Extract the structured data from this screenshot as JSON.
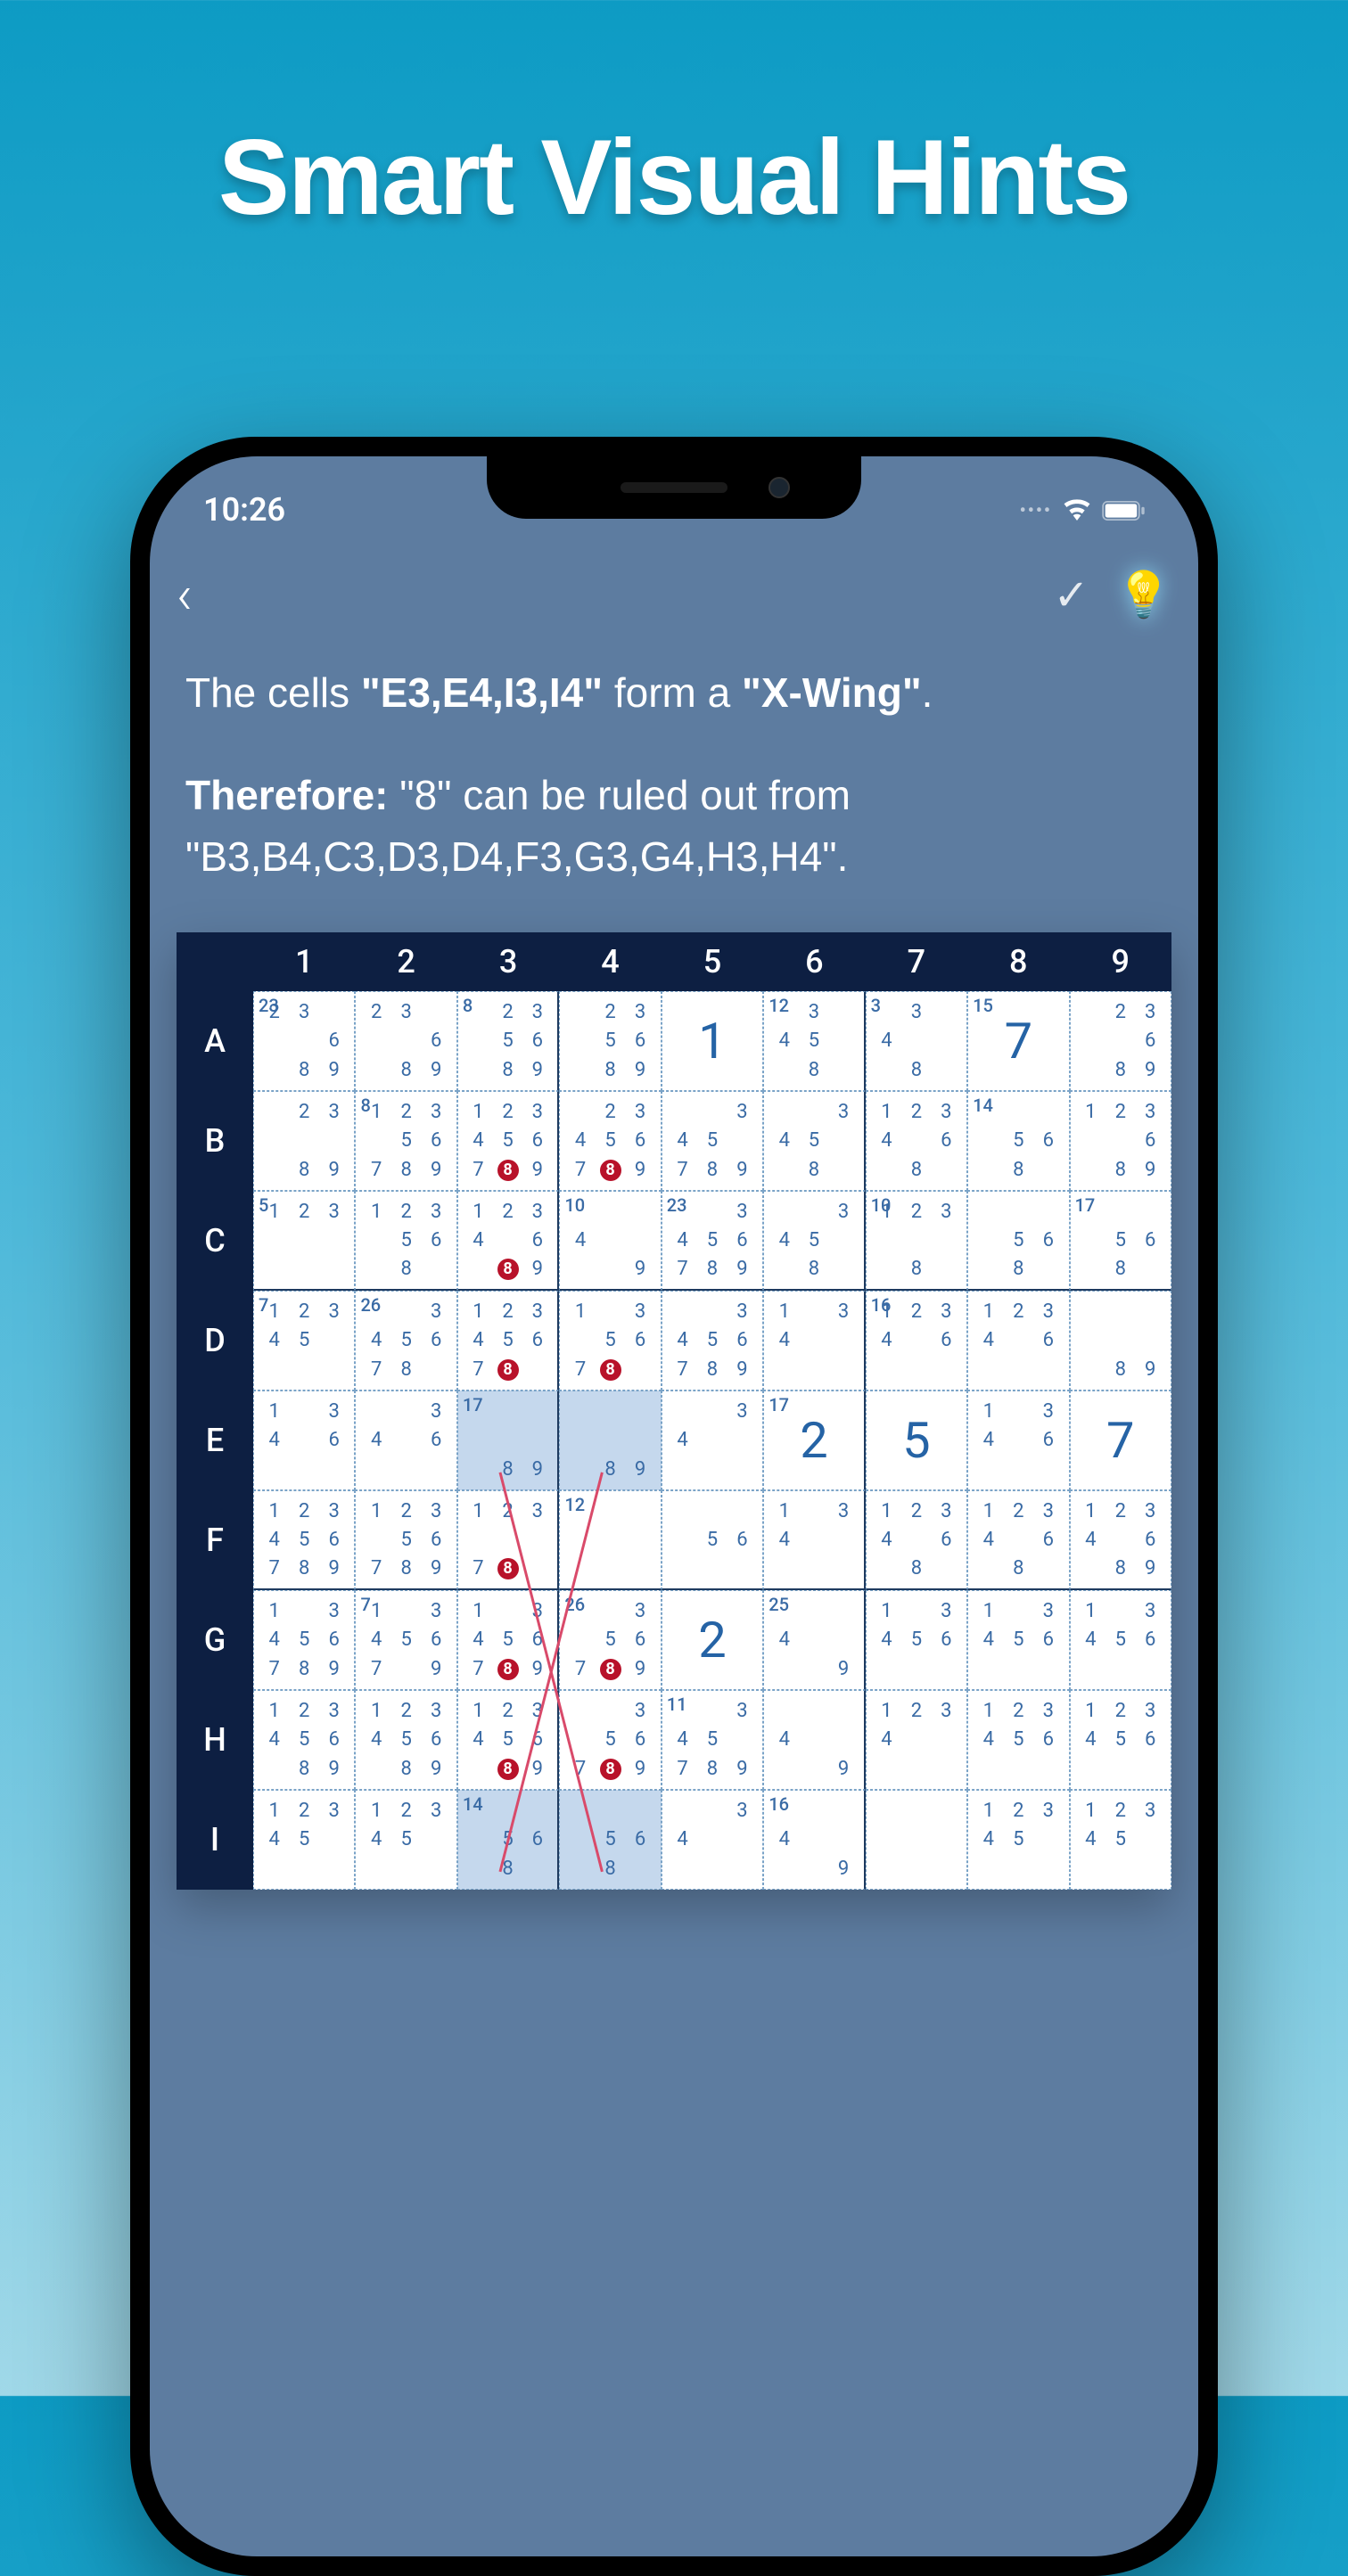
{
  "marketing_title": "Smart Visual Hints",
  "statusbar": {
    "time": "10:26"
  },
  "hint": {
    "line1_prefix": "The cells ",
    "line1_cells": "\"E3,E4,I3,I4\"",
    "line1_mid": " form a ",
    "line1_pattern": "\"X-Wing\"",
    "line1_suffix": ".",
    "line2_prefix": "Therefore: ",
    "line2_body": "\"8\" can be ruled out from \"B3,B4,C3,D3,D4,F3,G3,G4,H3,H4\"."
  },
  "columns": [
    "1",
    "2",
    "3",
    "4",
    "5",
    "6",
    "7",
    "8",
    "9"
  ],
  "rows": [
    "A",
    "B",
    "C",
    "D",
    "E",
    "F",
    "G",
    "H",
    "I"
  ],
  "big_values": {
    "A5": "1",
    "A8": "7",
    "E6": "2",
    "E7": "5",
    "E9": "7",
    "G5": "2"
  },
  "highlights": [
    "E3",
    "E4",
    "I3",
    "I4"
  ],
  "cages": {
    "A1": "23",
    "A3": "8",
    "A6": "12",
    "A7": "3",
    "A8": "15",
    "B2": "8",
    "B8": "14",
    "C1": "5",
    "C4": "10",
    "C5": "23",
    "C7": "10",
    "C9": "17",
    "D1": "7",
    "D2": "26",
    "D7": "16",
    "E3": "17",
    "E6": "17",
    "F4": "12",
    "G2": "7",
    "G4": "26",
    "G6": "25",
    "H5": "11",
    "I3": "14",
    "I6": "16"
  },
  "candidates": {
    "A1": [
      "2",
      "3",
      "",
      "",
      "",
      "6",
      "",
      "8",
      "9"
    ],
    "A2": [
      "2",
      "3",
      "",
      "",
      "",
      "6",
      "",
      "8",
      "9"
    ],
    "A3": [
      "",
      "2",
      "3",
      "",
      "5",
      "6",
      "",
      "8",
      "9"
    ],
    "A4": [
      "",
      "2",
      "3",
      "",
      "5",
      "6",
      "",
      "8",
      "9"
    ],
    "A6": [
      "",
      "3",
      "",
      "4",
      "5",
      "",
      "",
      "8",
      ""
    ],
    "A7": [
      "",
      "3",
      "",
      "4",
      "",
      "",
      "",
      "8",
      ""
    ],
    "A9": [
      "",
      "2",
      "3",
      "",
      "",
      "6",
      "",
      "8",
      "9"
    ],
    "B1": [
      "",
      "2",
      "3",
      "",
      "",
      "",
      "",
      "8",
      "9"
    ],
    "B2": [
      "1",
      "2",
      "3",
      "",
      "5",
      "6",
      "7",
      "8",
      "9"
    ],
    "B3": [
      "1",
      "2",
      "3",
      "4",
      "5",
      "6",
      "7",
      "8",
      "9"
    ],
    "B4": [
      "",
      "2",
      "3",
      "4",
      "5",
      "6",
      "7",
      "8",
      "9"
    ],
    "B5": [
      "",
      "",
      "3",
      "4",
      "5",
      "",
      "7",
      "8",
      "9"
    ],
    "B6": [
      "",
      "",
      "3",
      "4",
      "5",
      "",
      "",
      "8",
      ""
    ],
    "B7": [
      "1",
      "2",
      "3",
      "4",
      "",
      "6",
      "",
      "8",
      ""
    ],
    "B8": [
      "",
      "",
      "",
      "",
      "5",
      "6",
      "",
      "8",
      ""
    ],
    "B9": [
      "1",
      "2",
      "3",
      "",
      "",
      "6",
      "",
      "8",
      "9"
    ],
    "C1": [
      "1",
      "2",
      "3",
      "",
      "",
      "",
      "",
      "",
      ""
    ],
    "C2": [
      "1",
      "2",
      "3",
      "",
      "5",
      "6",
      "",
      "8",
      ""
    ],
    "C3": [
      "1",
      "2",
      "3",
      "4",
      "",
      "6",
      "",
      "8",
      "9"
    ],
    "C4": [
      "",
      "",
      "",
      "4",
      "",
      "",
      "",
      "",
      "9"
    ],
    "C5": [
      "",
      "",
      "3",
      "4",
      "5",
      "6",
      "7",
      "8",
      "9"
    ],
    "C6": [
      "",
      "",
      "3",
      "4",
      "5",
      "",
      "",
      "8",
      ""
    ],
    "C7": [
      "1",
      "2",
      "3",
      "",
      "",
      "",
      "",
      "8",
      ""
    ],
    "C8": [
      "",
      "",
      "",
      "",
      "5",
      "6",
      "",
      "8",
      ""
    ],
    "C9": [
      "",
      "",
      "",
      "",
      "5",
      "6",
      "",
      "8",
      ""
    ],
    "D1": [
      "1",
      "2",
      "3",
      "4",
      "5",
      "",
      "",
      "",
      ""
    ],
    "D2": [
      "",
      "",
      "3",
      "4",
      "5",
      "6",
      "7",
      "8",
      ""
    ],
    "D3": [
      "1",
      "2",
      "3",
      "4",
      "5",
      "6",
      "7",
      "8",
      ""
    ],
    "D4": [
      "1",
      "",
      "3",
      "",
      "5",
      "6",
      "7",
      "8",
      ""
    ],
    "D5": [
      "",
      "",
      "3",
      "4",
      "5",
      "6",
      "7",
      "8",
      "9"
    ],
    "D6": [
      "1",
      "",
      "3",
      "4",
      "",
      "",
      "",
      "",
      ""
    ],
    "D7": [
      "1",
      "2",
      "3",
      "4",
      "",
      "6",
      "",
      "",
      ""
    ],
    "D8": [
      "1",
      "2",
      "3",
      "4",
      "",
      "6",
      "",
      "",
      ""
    ],
    "D9": [
      "",
      "",
      "",
      "",
      "",
      "",
      "",
      "8",
      "9"
    ],
    "E1": [
      "1",
      "",
      "3",
      "4",
      "",
      "6",
      "",
      "",
      ""
    ],
    "E2": [
      "",
      "",
      "3",
      "4",
      "",
      "6",
      "",
      "",
      ""
    ],
    "E3": [
      "",
      "",
      "",
      "",
      "",
      "",
      "",
      "8",
      "9"
    ],
    "E4": [
      "",
      "",
      "",
      "",
      "",
      "",
      "",
      "8",
      "9"
    ],
    "E5": [
      "",
      "",
      "3",
      "4",
      "",
      "",
      "",
      "",
      ""
    ],
    "E8": [
      "1",
      "",
      "3",
      "4",
      "",
      "6",
      "",
      "",
      ""
    ],
    "F1": [
      "1",
      "2",
      "3",
      "4",
      "5",
      "6",
      "7",
      "8",
      "9"
    ],
    "F2": [
      "1",
      "2",
      "3",
      "",
      "5",
      "6",
      "7",
      "8",
      "9"
    ],
    "F3": [
      "1",
      "2",
      "3",
      "",
      "",
      "",
      "7",
      "8",
      ""
    ],
    "F4": [
      "",
      "",
      "",
      "",
      "",
      "",
      "",
      "",
      ""
    ],
    "F5": [
      "",
      "",
      "",
      "",
      "5",
      "6",
      "",
      "",
      ""
    ],
    "F6": [
      "1",
      "",
      "3",
      "4",
      "",
      "",
      "",
      "",
      ""
    ],
    "F7": [
      "1",
      "2",
      "3",
      "4",
      "",
      "6",
      "",
      "8",
      ""
    ],
    "F8": [
      "1",
      "2",
      "3",
      "4",
      "",
      "6",
      "",
      "8",
      ""
    ],
    "F9": [
      "1",
      "2",
      "3",
      "4",
      "",
      "6",
      "",
      "8",
      "9"
    ],
    "G1": [
      "1",
      "",
      "3",
      "4",
      "5",
      "6",
      "7",
      "8",
      "9"
    ],
    "G2": [
      "1",
      "",
      "3",
      "4",
      "5",
      "6",
      "7",
      "",
      "9"
    ],
    "G3": [
      "1",
      "",
      "3",
      "4",
      "5",
      "6",
      "7",
      "8",
      "9"
    ],
    "G4": [
      "",
      "",
      "3",
      "",
      "5",
      "6",
      "7",
      "8",
      "9"
    ],
    "G6": [
      "",
      "",
      "",
      "4",
      "",
      "",
      "",
      "",
      "9"
    ],
    "G7": [
      "1",
      "",
      "3",
      "4",
      "5",
      "6",
      "",
      "",
      ""
    ],
    "G8": [
      "1",
      "",
      "3",
      "4",
      "5",
      "6",
      "",
      "",
      ""
    ],
    "G9": [
      "1",
      "",
      "3",
      "4",
      "5",
      "6",
      "",
      "",
      ""
    ],
    "H1": [
      "1",
      "2",
      "3",
      "4",
      "5",
      "6",
      "",
      "8",
      "9"
    ],
    "H2": [
      "1",
      "2",
      "3",
      "4",
      "5",
      "6",
      "",
      "8",
      "9"
    ],
    "H3": [
      "1",
      "2",
      "3",
      "4",
      "5",
      "6",
      "",
      "8",
      "9"
    ],
    "H4": [
      "",
      "",
      "3",
      "",
      "5",
      "6",
      "7",
      "8",
      "9"
    ],
    "H5": [
      "",
      "",
      "3",
      "4",
      "5",
      "",
      "7",
      "8",
      "9"
    ],
    "H6": [
      "",
      "",
      "",
      "4",
      "",
      "",
      "",
      "",
      "9"
    ],
    "H7": [
      "1",
      "2",
      "3",
      "4",
      "",
      "",
      "",
      "",
      ""
    ],
    "H8": [
      "1",
      "2",
      "3",
      "4",
      "5",
      "6",
      "",
      "",
      ""
    ],
    "H9": [
      "1",
      "2",
      "3",
      "4",
      "5",
      "6",
      "",
      "",
      ""
    ],
    "I1": [
      "1",
      "2",
      "3",
      "4",
      "5",
      "",
      "",
      "",
      ""
    ],
    "I2": [
      "1",
      "2",
      "3",
      "4",
      "5",
      "",
      "",
      "",
      ""
    ],
    "I3": [
      "",
      "",
      "",
      "",
      "5",
      "6",
      "",
      "8",
      ""
    ],
    "I4": [
      "",
      "",
      "",
      "",
      "5",
      "6",
      "",
      "8",
      ""
    ],
    "I5": [
      "",
      "",
      "3",
      "4",
      "",
      "",
      "",
      "",
      ""
    ],
    "I6": [
      "",
      "",
      "",
      "4",
      "",
      "",
      "",
      "",
      "9"
    ],
    "I7": [
      "",
      "",
      "",
      "",
      "",
      "",
      "",
      "",
      ""
    ],
    "I8": [
      "1",
      "2",
      "3",
      "4",
      "5",
      "",
      "",
      "",
      ""
    ],
    "I9": [
      "1",
      "2",
      "3",
      "4",
      "5",
      "",
      "",
      "",
      ""
    ]
  },
  "eliminated": {
    "B3": 8,
    "B4": 8,
    "C3": 8,
    "D3": 8,
    "D4": 8,
    "F3": 8,
    "G3": 8,
    "G4": 8,
    "H3": 8,
    "H4": 8
  }
}
